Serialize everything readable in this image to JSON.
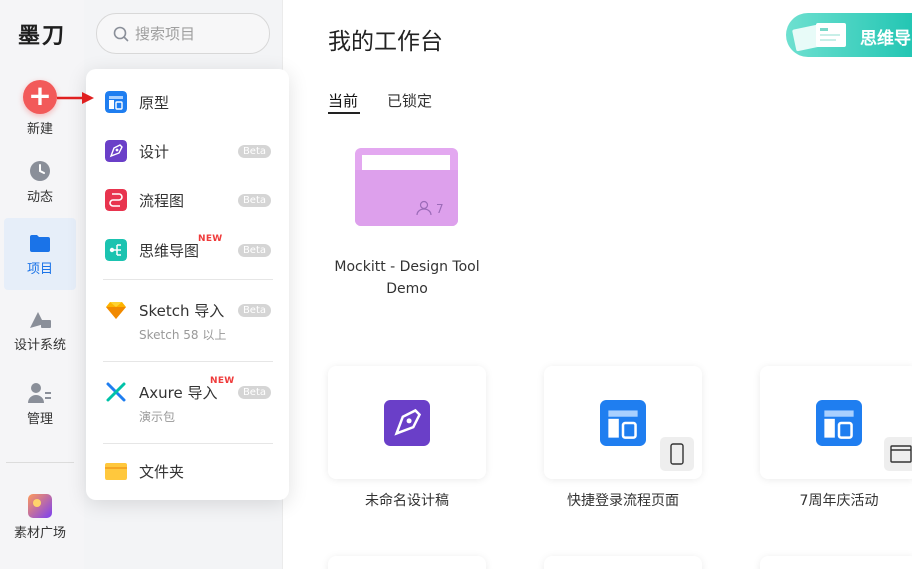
{
  "app": {
    "logo": "墨刀"
  },
  "rail": {
    "new_label": "新建",
    "items": [
      {
        "label": "动态",
        "icon": "clock-icon"
      },
      {
        "label": "项目",
        "icon": "folder-icon"
      },
      {
        "label": "设计系统",
        "icon": "design-system-icon"
      },
      {
        "label": "管理",
        "icon": "users-icon"
      },
      {
        "label": "素材广场",
        "icon": "gallery-icon"
      }
    ]
  },
  "search": {
    "placeholder": "搜索项目"
  },
  "menu": {
    "items": [
      {
        "label": "原型",
        "icon": "prototype-icon"
      },
      {
        "label": "设计",
        "badge": "Beta",
        "icon": "pen-icon"
      },
      {
        "label": "流程图",
        "badge": "Beta",
        "icon": "flowchart-icon"
      },
      {
        "label": "思维导图",
        "badge": "Beta",
        "tag": "NEW",
        "icon": "mindmap-icon"
      },
      {
        "label": "Sketch 导入",
        "sub": "Sketch 58 以上",
        "badge": "Beta",
        "icon": "sketch-icon"
      },
      {
        "label": "Axure 导入",
        "sub": "演示包",
        "badge": "Beta",
        "tag": "NEW",
        "icon": "axure-icon"
      },
      {
        "label": "文件夹",
        "icon": "folder-icon"
      }
    ]
  },
  "main": {
    "title": "我的工作台",
    "banner": "思维导",
    "tabs": [
      {
        "label": "当前"
      },
      {
        "label": "已锁定"
      }
    ],
    "folder": {
      "name": "Mockitt - Design Tool Demo",
      "members": "7"
    },
    "cards": [
      {
        "title": "未命名设计稿",
        "type": "design"
      },
      {
        "title": "快捷登录流程页面",
        "type": "prototype",
        "device": "phone"
      },
      {
        "title": "7周年庆活动",
        "type": "prototype",
        "device": "web"
      }
    ]
  },
  "colors": {
    "accent": "#1a73e8",
    "new_button": "#f25a5a",
    "new_tag": "#ef3b3b",
    "folder": "#e3a8f0",
    "design_purple": "#6a3fc8",
    "teal": "#1bc3b0"
  }
}
